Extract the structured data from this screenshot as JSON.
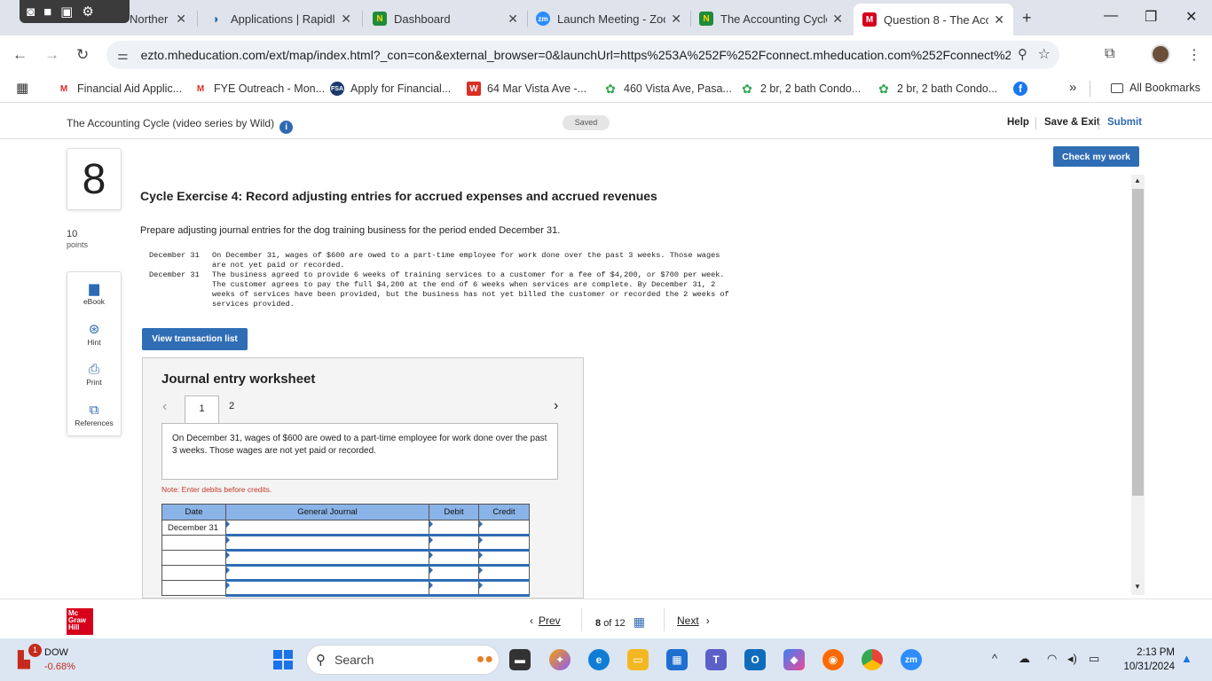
{
  "browser": {
    "tabs": [
      {
        "label": "Norther",
        "favicon": "N"
      },
      {
        "label": "Applications | Rapidlo",
        "favicon": "R"
      },
      {
        "label": "Dashboard",
        "favicon": "N"
      },
      {
        "label": "Launch Meeting - Zoo",
        "favicon": "zm"
      },
      {
        "label": "The Accounting Cycle",
        "favicon": "N"
      },
      {
        "label": "Question 8 - The Acco",
        "favicon": "M"
      }
    ],
    "url": "ezto.mheducation.com/ext/map/index.html?_con=con&external_browser=0&launchUrl=https%253A%252F%252Fconnect.mheducation.com%252Fconnect%25...",
    "bookmarks": [
      {
        "label": "Financial Aid Applic...",
        "icon": "gmail-icon"
      },
      {
        "label": "FYE Outreach - Mon...",
        "icon": "gmail-icon"
      },
      {
        "label": "Apply for Financial...",
        "icon": "fsa-icon"
      },
      {
        "label": "64 Mar Vista Ave -...",
        "icon": "w-icon"
      },
      {
        "label": "460 Vista Ave, Pasa...",
        "icon": "flower-icon"
      },
      {
        "label": "2 br, 2 bath Condo...",
        "icon": "flower-icon"
      },
      {
        "label": "2 br, 2 bath Condo...",
        "icon": "flower-icon"
      }
    ],
    "all_bookmarks": "All Bookmarks",
    "overflow": "»"
  },
  "header": {
    "assignment_title": "The Accounting Cycle (video series by Wild)",
    "saved": "Saved",
    "help": "Help",
    "save_exit": "Save & Exit",
    "submit": "Submit",
    "check_work": "Check my work"
  },
  "question": {
    "number": "8",
    "points_value": "10",
    "points_label": "points",
    "title": "Cycle Exercise 4: Record adjusting entries for accrued expenses and accrued revenues",
    "prompt": "Prepare adjusting journal entries for the dog training business for the period ended December 31.",
    "transactions": [
      {
        "date": "December 31",
        "lines": [
          "On December 31, wages of $600 are owed to a part-time employee for work done over the past 3 weeks. Those wages",
          "are not yet paid or recorded."
        ]
      },
      {
        "date": "December 31",
        "lines": [
          "The business agreed to provide 6 weeks of training services to a customer for a fee of $4,200, or $700 per week.",
          "The customer agrees to pay the full $4,200 at the end of 6 weeks when services are complete. By December 31, 2",
          "weeks of services have been provided, but the business has not yet billed the customer or recorded the 2 weeks of",
          "services provided."
        ]
      }
    ],
    "view_transactions": "View transaction list"
  },
  "tools": [
    {
      "label": "eBook",
      "icon": "book-icon"
    },
    {
      "label": "Hint",
      "icon": "lifebuoy-icon"
    },
    {
      "label": "Print",
      "icon": "printer-icon"
    },
    {
      "label": "References",
      "icon": "copy-icon"
    }
  ],
  "worksheet": {
    "title": "Journal entry worksheet",
    "tabs": [
      "1",
      "2"
    ],
    "description": "On December 31, wages of $600 are owed to a part-time employee for work done over the past 3 weeks. Those wages are not yet paid or recorded.",
    "note": "Note: Enter debits before credits.",
    "columns": [
      "Date",
      "General Journal",
      "Debit",
      "Credit"
    ],
    "rows": [
      {
        "date": "December 31"
      },
      {
        "date": ""
      },
      {
        "date": ""
      },
      {
        "date": ""
      },
      {
        "date": ""
      }
    ]
  },
  "footer": {
    "prev": "Prev",
    "current": "8",
    "of": "of",
    "total": "12",
    "next": "Next",
    "logo": "Mc Graw Hill"
  },
  "taskbar": {
    "stock_name": "DOW",
    "stock_change": "-0.68%",
    "notif_count": "1",
    "search_placeholder": "Search",
    "time": "2:13 PM",
    "date": "10/31/2024"
  }
}
